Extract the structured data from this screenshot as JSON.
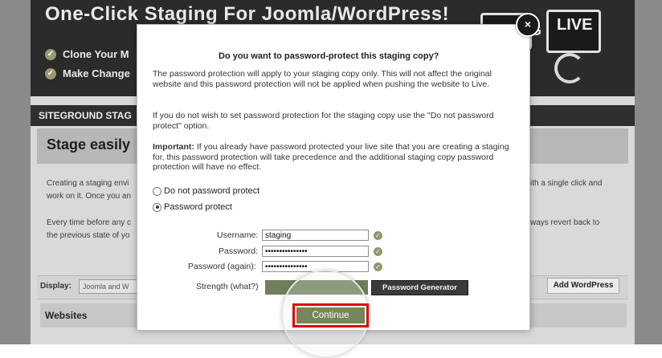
{
  "background": {
    "hero_title": "One-Click Staging For Joomla/WordPress!",
    "hero_bullets": [
      "Clone Your M",
      "Make Change"
    ],
    "live_label": "LIVE",
    "live_partial": "G",
    "siteground_bar": "SITEGROUND STAG",
    "stage_heading": "Stage easily",
    "desc_lines": [
      {
        "left": "Creating a staging envi",
        "right": "ith a single click and"
      },
      {
        "left": "work on it. Once you an",
        "right": ""
      },
      {
        "left": "Every time before any c",
        "right": "ways revert back to"
      },
      {
        "left": "the previous state of yo",
        "right": ""
      }
    ],
    "display_label": "Display:",
    "display_value": "Joomla and W",
    "add_wordpress": "Add WordPress",
    "websites_heading": "Websites"
  },
  "modal": {
    "close_label": "×",
    "title": "Do you want to password-protect this staging copy?",
    "para1": "The password protection will apply to your staging copy only. This will not affect the original website and this password protection will not be applied when pushing the website to Live.",
    "para2": "If you do not wish to set password protection for the staging copy use the \"Do not password protect\" option.",
    "para3_bold": "Important:",
    "para3": " If you already have password protected your live site that you are creating a staging for, this password protection will take precedence and the additional staging copy password protection will have no effect.",
    "radio_none": "Do not password protect",
    "radio_protect": "Password protect",
    "selected_option": "Password protect",
    "username_label": "Username:",
    "username_value": "staging",
    "password_label": "Password:",
    "password_value": "•••••••••••••••",
    "password_again_label": "Password (again):",
    "password_again_value": "•••••••••••••••",
    "strength_label": "Strength (what?)",
    "generator_label": "Password Generator",
    "continue_label": "Continue"
  },
  "colors": {
    "accent_green": "#76855c",
    "highlight_red": "#e00000",
    "dark": "#2b2b2b"
  }
}
